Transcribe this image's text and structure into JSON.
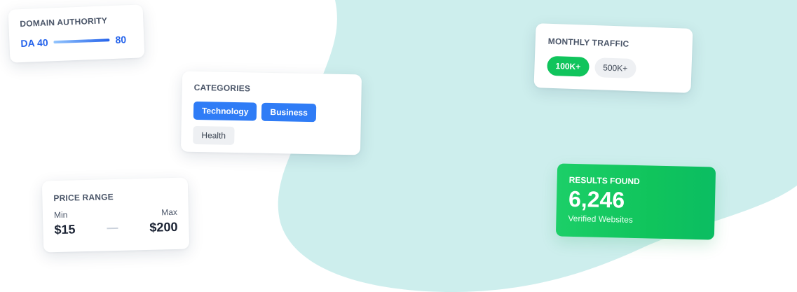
{
  "colors": {
    "blob": "#cdeeed",
    "accent_blue": "#2563eb",
    "accent_green": "#10c45c"
  },
  "domain_authority": {
    "label": "DOMAIN AUTHORITY",
    "min_label": "DA 40",
    "max_label": "80"
  },
  "categories": {
    "label": "CATEGORIES",
    "tags": [
      {
        "label": "Technology",
        "selected": true
      },
      {
        "label": "Business",
        "selected": true
      },
      {
        "label": "Health",
        "selected": false
      }
    ]
  },
  "price_range": {
    "label": "PRICE RANGE",
    "min_label": "Min",
    "min_value": "$15",
    "max_label": "Max",
    "max_value": "$200"
  },
  "monthly_traffic": {
    "label": "MONTHLY TRAFFIC",
    "options": [
      {
        "label": "100K+",
        "selected": true
      },
      {
        "label": "500K+",
        "selected": false
      }
    ]
  },
  "results": {
    "label": "RESULTS FOUND",
    "count": "6,246",
    "subtitle": "Verified Websites"
  }
}
